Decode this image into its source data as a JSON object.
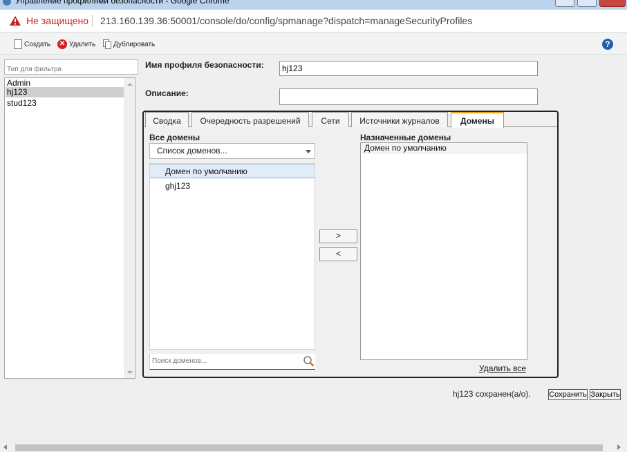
{
  "window": {
    "title": "Управление профилями безопасности - Google Chrome"
  },
  "address_bar": {
    "security_label": "Не защищено",
    "url": "213.160.139.36:50001/console/do/config/spmanage?dispatch=manageSecurityProfiles"
  },
  "toolbar": {
    "create_label": "Создать",
    "delete_label": "Удалить",
    "duplicate_label": "Дублировать",
    "help_label": "?"
  },
  "left_panel": {
    "filter_placeholder": "Тип для фильтра",
    "profiles": [
      "Admin",
      "hj123",
      "stud123"
    ],
    "selected_profile": "hj123"
  },
  "form": {
    "profile_name_label": "Имя профиля безопасности:",
    "profile_name_value": "hj123",
    "description_label": "Описание:",
    "description_value": ""
  },
  "tabs": [
    {
      "label": "Сводка"
    },
    {
      "label": "Очередность разрешений"
    },
    {
      "label": "Сети"
    },
    {
      "label": "Источники журналов"
    },
    {
      "label": "Домены"
    }
  ],
  "active_tab": "Домены",
  "domains": {
    "all_domains_label": "Все домены",
    "domain_dropdown_value": "Список доменов...",
    "available": [
      "Домен по умолчанию",
      "ghj123"
    ],
    "highlighted": "Домен по умолчанию",
    "search_placeholder": "Поиск доменов...",
    "add_button": ">",
    "remove_button": "<",
    "assigned_label": "Назначенные домены",
    "assigned": [
      "Домен по умолчанию"
    ],
    "remove_all_link": "Удалить все"
  },
  "footer": {
    "status_text": "hj123 сохранен(а/о).",
    "save_button": "Сохранить",
    "close_button": "Закрыть"
  },
  "colors": {
    "insecure_red": "#c5221f",
    "active_tab_accent": "#f0a21c",
    "row_highlight": "#e1ecf8",
    "selected_profile_bg": "#cfcfcf"
  }
}
